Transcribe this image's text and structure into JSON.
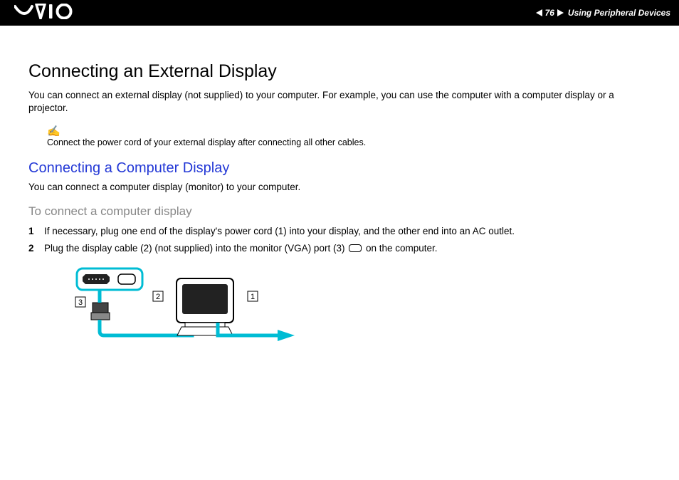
{
  "header": {
    "page_number": "76",
    "section_title": "Using Peripheral Devices",
    "logo_alt": "VAIO"
  },
  "content": {
    "title": "Connecting an External Display",
    "intro": "You can connect an external display (not supplied) to your computer. For example, you can use the computer with a computer display or a projector.",
    "note_icon": "✍",
    "note": "Connect the power cord of your external display after connecting all other cables.",
    "subtitle": "Connecting a Computer Display",
    "sub_intro": "You can connect a computer display (monitor) to your computer.",
    "task_heading": "To connect a computer display",
    "steps": [
      "If necessary, plug one end of the display's power cord (1) into your display, and the other end into an AC outlet.",
      "Plug the display cable (2) (not supplied) into the monitor (VGA) port (3) ▭ on the computer."
    ],
    "diagram_labels": {
      "l1": "1",
      "l2": "2",
      "l3": "3"
    }
  }
}
